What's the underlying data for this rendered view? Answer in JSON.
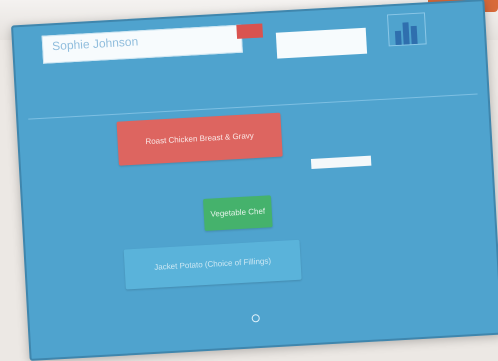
{
  "person": {
    "name": "Sophie Johnson"
  },
  "header": {
    "info_lines": [
      "",
      "",
      ""
    ]
  },
  "menu": {
    "main_option": "Roast Chicken Breast & Gravy",
    "side_option": "Vegetable Chef",
    "potato_option": "Jacket Potato (Choice of Fillings)"
  },
  "colors": {
    "screen_bg": "#4fa3ce",
    "main_option": "#dd6560",
    "side_option": "#45b26c",
    "potato_option": "#5ab3da"
  }
}
